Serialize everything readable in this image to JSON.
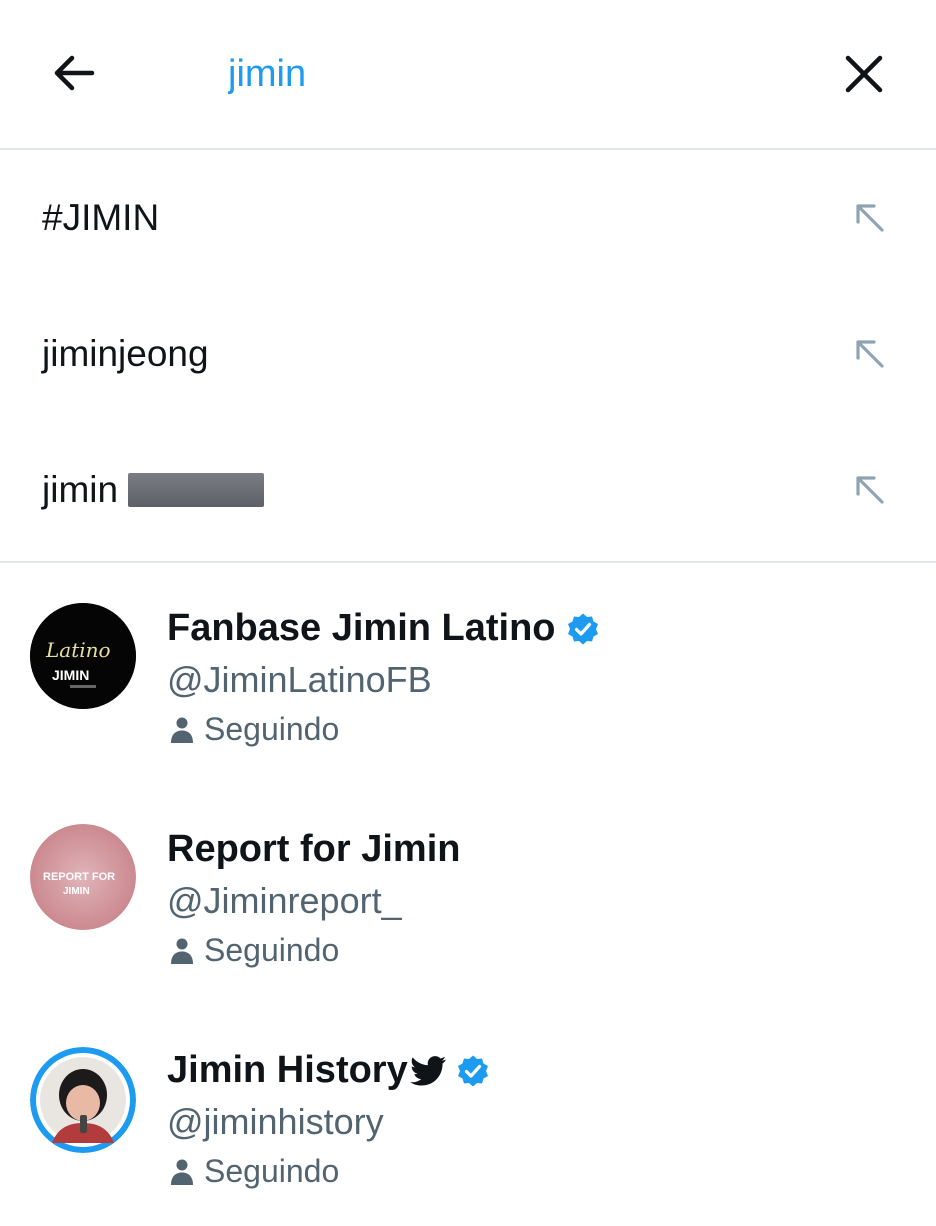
{
  "search": {
    "query": "jimin"
  },
  "icons": {
    "back": "arrow-left-icon",
    "clear": "close-icon",
    "fill_suggestion": "arrow-up-left-icon",
    "verified": "verified-badge-icon",
    "following": "person-icon",
    "bird": "twitter-bird-icon"
  },
  "colors": {
    "accent": "#1d9bf0",
    "secondary_text": "#536471",
    "divider": "#e1e6ea",
    "fill_arrow": "#8fa4b3"
  },
  "suggestions": [
    {
      "label": "#JIMIN"
    },
    {
      "label": "jiminjeong"
    },
    {
      "label": "jimin",
      "redacted": true
    }
  ],
  "users": [
    {
      "name": "Fanbase Jimin Latino",
      "handle": "@JiminLatinoFB",
      "verified": true,
      "status": "Seguindo",
      "avatar_text_script": "Latino",
      "avatar_text_main": "JIMIN"
    },
    {
      "name": "Report for Jimin",
      "handle": "@Jiminreport_",
      "verified": false,
      "status": "Seguindo",
      "avatar_text_line1": "REPORT FOR",
      "avatar_text_line2": "JIMIN"
    },
    {
      "name": "Jimin History",
      "handle": "@jiminhistory",
      "verified": true,
      "status": "Seguindo"
    }
  ]
}
